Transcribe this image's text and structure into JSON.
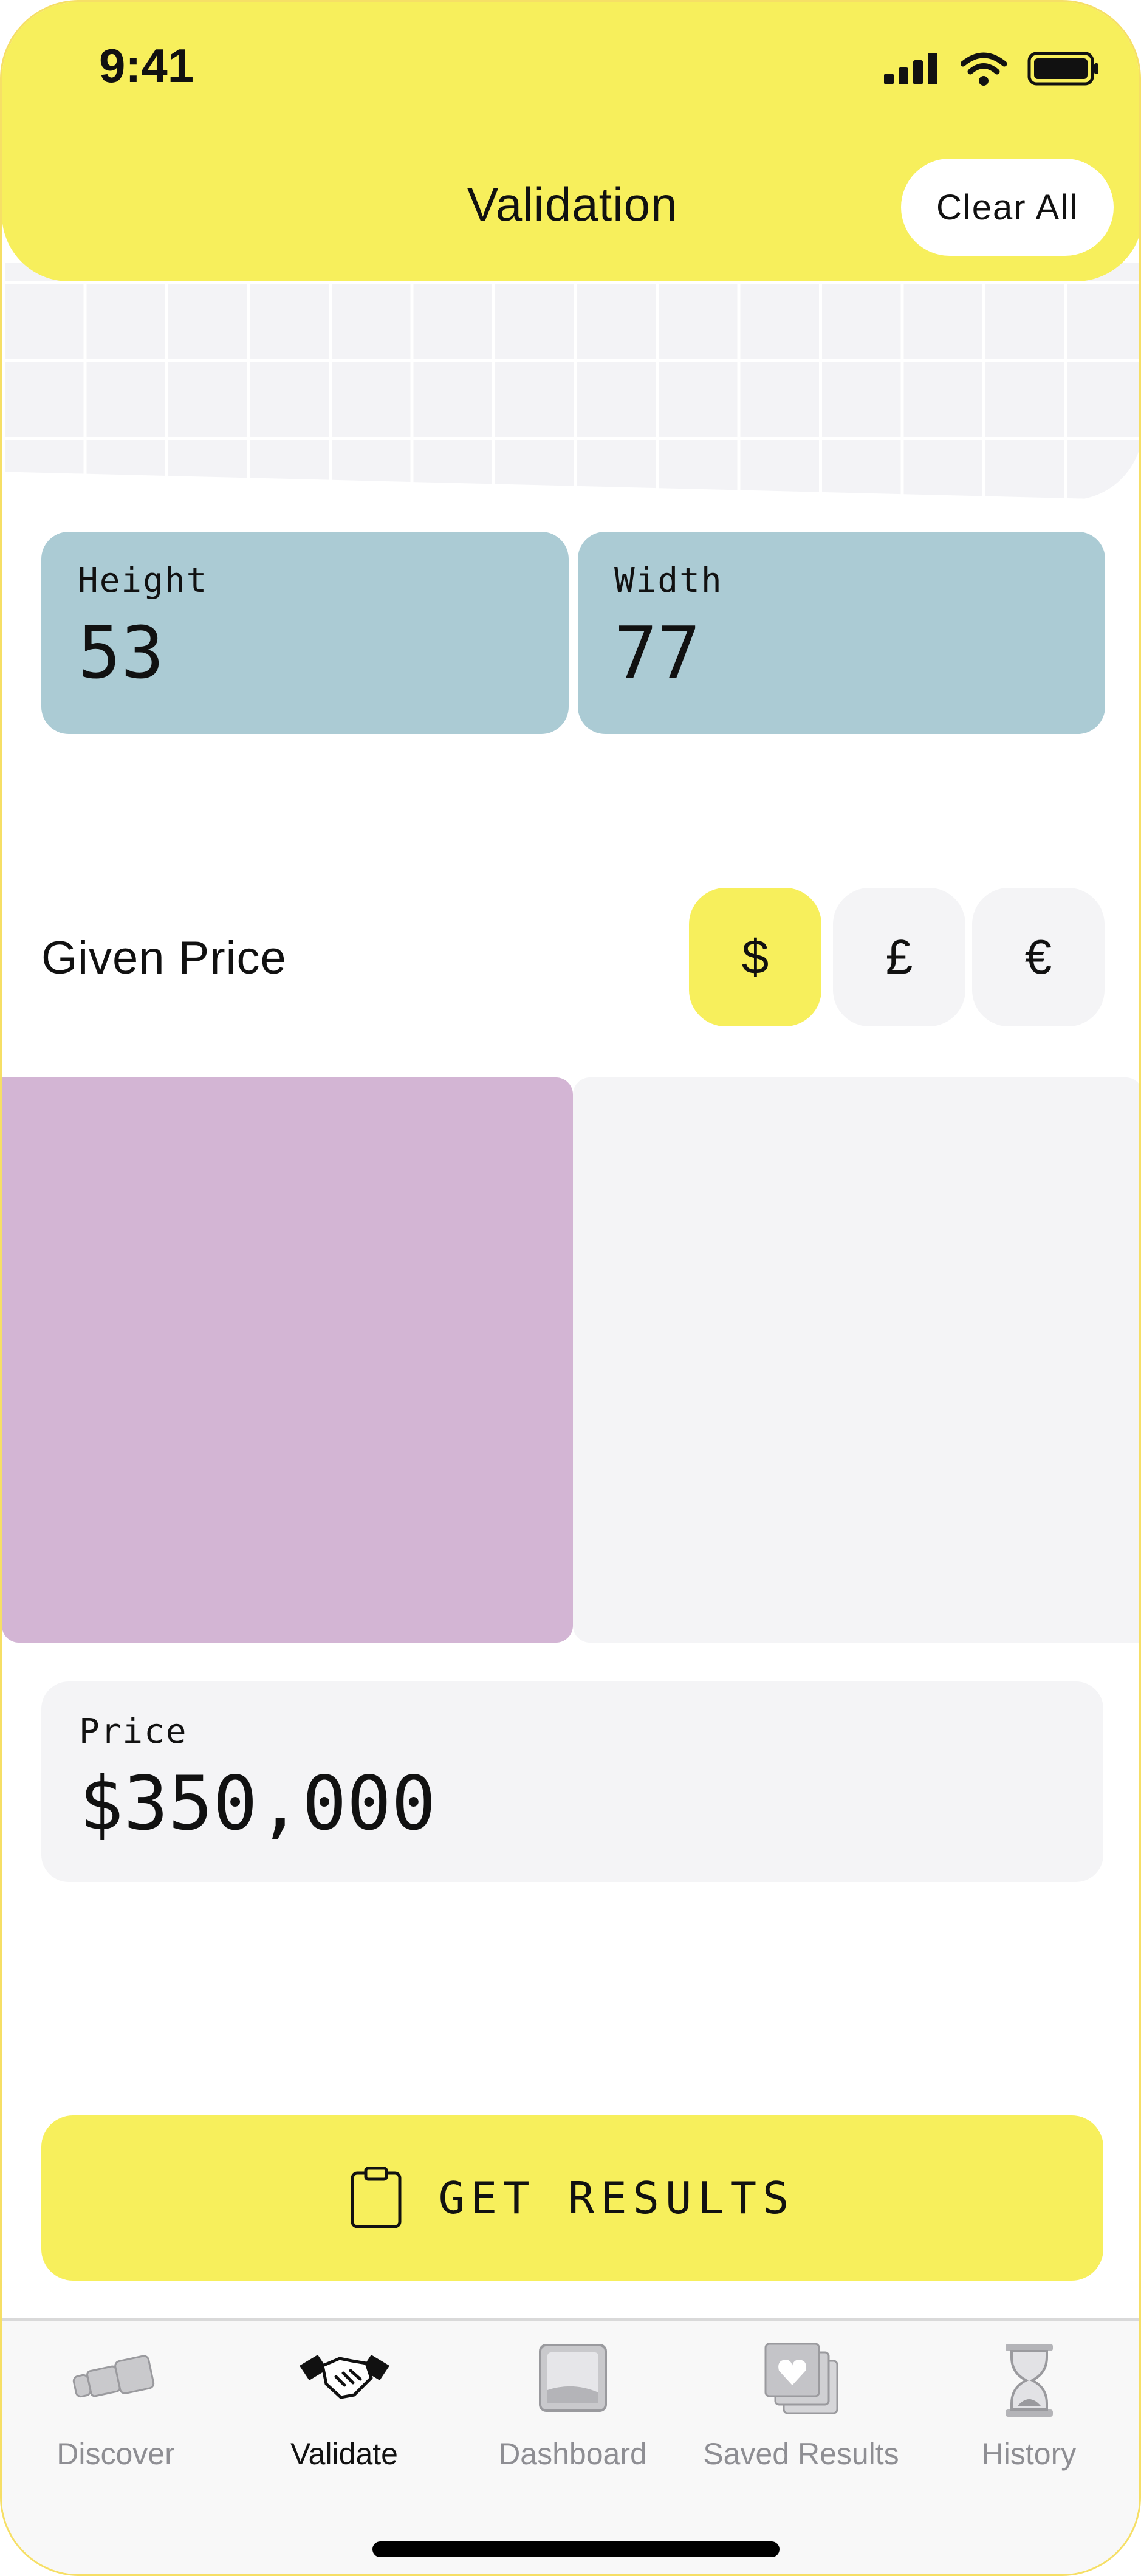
{
  "status_bar": {
    "time": "9:41"
  },
  "header": {
    "title": "Validation",
    "clear_label": "Clear All"
  },
  "dimensions": {
    "height": {
      "label": "Height",
      "value": "53"
    },
    "width": {
      "label": "Width",
      "value": "77"
    }
  },
  "given_price": {
    "label": "Given Price",
    "currencies": [
      {
        "symbol": "$",
        "selected": true
      },
      {
        "symbol": "£",
        "selected": false
      },
      {
        "symbol": "€",
        "selected": false
      }
    ]
  },
  "swatches": {
    "left_color": "#d3b5d4",
    "right_color": "#f4f4f6"
  },
  "price": {
    "label": "Price",
    "value": "$350,000"
  },
  "action": {
    "label": "GET RESULTS",
    "icon": "clipboard-icon"
  },
  "tabs": [
    {
      "label": "Discover",
      "icon": "telescope-icon",
      "active": false
    },
    {
      "label": "Validate",
      "icon": "handshake-icon",
      "active": true
    },
    {
      "label": "Dashboard",
      "icon": "dashboard-icon",
      "active": false
    },
    {
      "label": "Saved Results",
      "icon": "saved-results-icon",
      "active": false
    },
    {
      "label": "History",
      "icon": "hourglass-icon",
      "active": false
    }
  ],
  "colors": {
    "accent": "#f7ef5c",
    "field_blue": "#abcbd4",
    "muted": "#8e8e93"
  }
}
